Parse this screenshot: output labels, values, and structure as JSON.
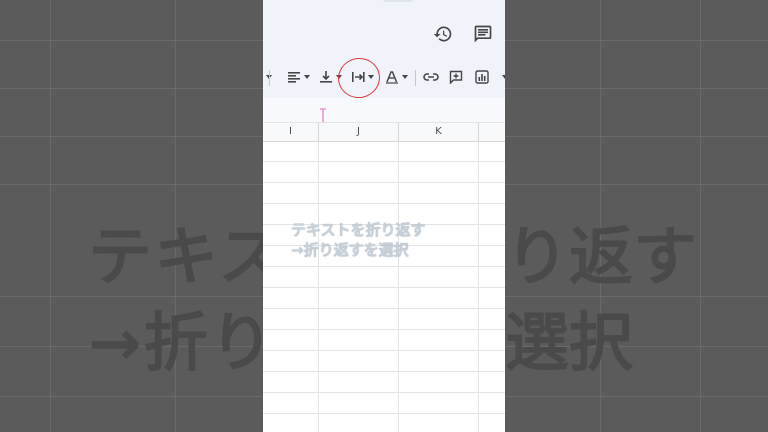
{
  "background_caption": {
    "line1": "テキスト",
    "line2": "→折り",
    "line1_right": "り返す",
    "line2_right": "選択"
  },
  "caption": {
    "line1": "テキストを折り返す",
    "line2": "→折り返すを選択"
  },
  "toolbar": {
    "icons": [
      "align-horizontal-icon",
      "align-vertical-icon",
      "text-wrap-icon",
      "text-rotation-icon",
      "insert-link-icon",
      "insert-comment-icon",
      "insert-chart-icon"
    ],
    "highlighted": "text-wrap-icon"
  },
  "columns": [
    "I",
    "J",
    "K"
  ],
  "colors": {
    "annotation_ring": "#d93a3a",
    "toolbar_bg": "#f0f3f9"
  }
}
